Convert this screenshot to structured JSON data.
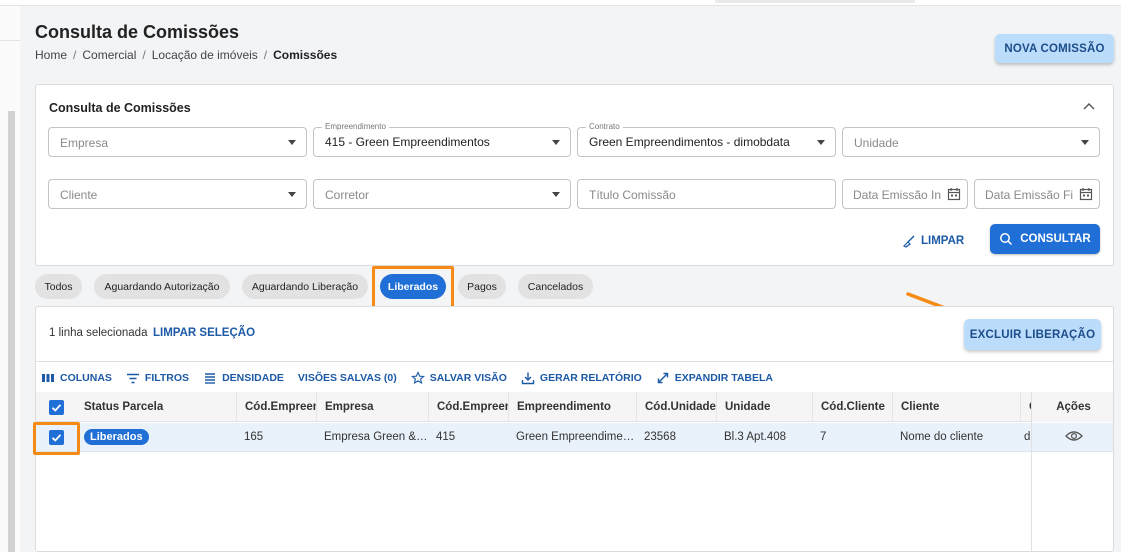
{
  "page": {
    "title": "Consulta de Comissões",
    "breadcrumb": [
      "Home",
      "Comercial",
      "Locação de imóveis",
      "Comissões"
    ],
    "new_button": "NOVA COMISSÃO"
  },
  "filters": {
    "title": "Consulta de Comissões",
    "empresa": {
      "placeholder": "Empresa"
    },
    "empreendimento": {
      "label": "Empreendimento",
      "value": "415 - Green Empreendimentos"
    },
    "contrato": {
      "label": "Contrato",
      "value": "Green Empreendimentos - dimobdata"
    },
    "unidade": {
      "placeholder": "Unidade"
    },
    "cliente": {
      "placeholder": "Cliente"
    },
    "corretor": {
      "placeholder": "Corretor"
    },
    "titulo": {
      "placeholder": "Título Comissão"
    },
    "data_inicio": {
      "placeholder": "Data Emissão Inicial"
    },
    "data_fim": {
      "placeholder": "Data Emissão Final"
    },
    "clear_label": "LIMPAR",
    "search_label": "CONSULTAR"
  },
  "status_tabs": [
    "Todos",
    "Aguardando Autorização",
    "Aguardando Liberação",
    "Liberados",
    "Pagos",
    "Cancelados"
  ],
  "active_tab": "Liberados",
  "selection": {
    "text": "1 linha selecionada",
    "clear": "LIMPAR SELEÇÃO",
    "action": "EXCLUIR LIBERAÇÃO"
  },
  "toolbar": [
    "COLUNAS",
    "FILTROS",
    "DENSIDADE",
    "VISÕES SALVAS (0)",
    "SALVAR VISÃO",
    "GERAR RELATÓRIO",
    "EXPANDIR TABELA"
  ],
  "table": {
    "headers": [
      "Status Parcela",
      "Cód.Empreendimento",
      "Empresa",
      "Cód.Empreendimento",
      "Empreendimento",
      "Cód.Unidade",
      "Unidade",
      "Cód.Cliente",
      "Cliente",
      "C",
      "Ações"
    ],
    "rows": [
      {
        "status": "Liberados",
        "cod_empresa": "165",
        "empresa": "Empresa Green & Co",
        "cod_empreendimento": "415",
        "empreendimento": "Green Empreendimentos",
        "cod_unidade": "23568",
        "unidade": "Bl.3 Apt.408",
        "cod_cliente": "7",
        "cliente": "Nome do cliente",
        "extra": "d"
      }
    ]
  },
  "colors": {
    "primary": "#1f6fd6",
    "primary_light": "#bcdcfb",
    "highlight": "#f58a14"
  },
  "icons": {
    "collapse": "chevron-up-icon",
    "calendar": "calendar-icon",
    "search": "search-icon",
    "broom": "broom-icon",
    "view": "eye-icon"
  }
}
